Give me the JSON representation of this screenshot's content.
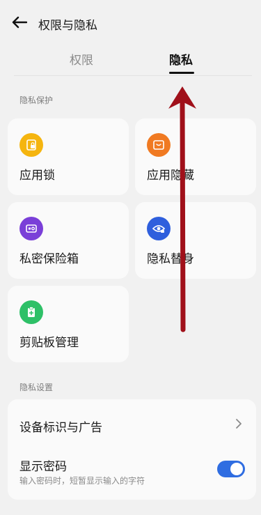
{
  "header": {
    "title": "权限与隐私",
    "back_icon": "arrow-left-icon"
  },
  "tabs": [
    {
      "label": "权限",
      "active": false
    },
    {
      "label": "隐私",
      "active": true
    }
  ],
  "privacy_protection": {
    "title": "隐私保护",
    "items": [
      {
        "label": "应用锁",
        "icon": "app-lock-icon",
        "color": "#f5b50f"
      },
      {
        "label": "应用隐藏",
        "icon": "app-hide-icon",
        "color": "#f07a22"
      },
      {
        "label": "私密保险箱",
        "icon": "safe-box-icon",
        "color": "#7a3fd8"
      },
      {
        "label": "隐私替身",
        "icon": "privacy-eye-icon",
        "color": "#2f5fdd"
      },
      {
        "label": "剪贴板管理",
        "icon": "clipboard-icon",
        "color": "#2ec067"
      }
    ]
  },
  "privacy_settings": {
    "title": "隐私设置",
    "ads_label": "设备标识与广告",
    "show_password_label": "显示密码",
    "show_password_desc": "输入密码时，短暂显示输入的字符",
    "show_password_on": true
  },
  "colors": {
    "accent": "#2f6de1",
    "annotation_arrow": "#a0101a"
  }
}
